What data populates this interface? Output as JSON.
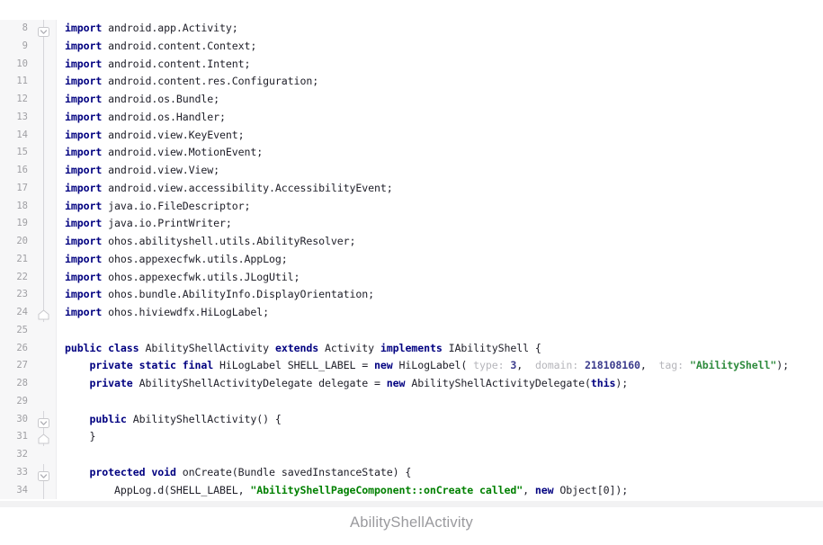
{
  "caption": "AbilityShellActivity",
  "editor": {
    "language": "Java",
    "first_visible_line": 8,
    "last_visible_line": 34,
    "colors": {
      "background": "#ffffff",
      "gutter_background": "#f7f7f8",
      "line_number": "#a0a0a4",
      "keyword": "#000080",
      "string": "#008000",
      "number": "#0000c0",
      "plain_text": "#20202a",
      "inlay_hint_label": "#b6b6bb",
      "caption_text": "#9a9a9e"
    },
    "fold_markers": [
      {
        "line": 8,
        "glyph": "chevron-down-icon"
      },
      {
        "line": 24,
        "glyph": "fold-end-icon"
      },
      {
        "line": 30,
        "glyph": "chevron-down-icon"
      },
      {
        "line": 31,
        "glyph": "fold-end-icon"
      },
      {
        "line": 33,
        "glyph": "chevron-down-icon"
      }
    ],
    "lines": [
      {
        "num": "8",
        "tokens": [
          {
            "t": "kw",
            "v": "import"
          },
          {
            "t": "plain",
            "v": " android.app.Activity;"
          }
        ]
      },
      {
        "num": "9",
        "tokens": [
          {
            "t": "kw",
            "v": "import"
          },
          {
            "t": "plain",
            "v": " android.content.Context;"
          }
        ]
      },
      {
        "num": "10",
        "tokens": [
          {
            "t": "kw",
            "v": "import"
          },
          {
            "t": "plain",
            "v": " android.content.Intent;"
          }
        ]
      },
      {
        "num": "11",
        "tokens": [
          {
            "t": "kw",
            "v": "import"
          },
          {
            "t": "plain",
            "v": " android.content.res.Configuration;"
          }
        ]
      },
      {
        "num": "12",
        "tokens": [
          {
            "t": "kw",
            "v": "import"
          },
          {
            "t": "plain",
            "v": " android.os.Bundle;"
          }
        ]
      },
      {
        "num": "13",
        "tokens": [
          {
            "t": "kw",
            "v": "import"
          },
          {
            "t": "plain",
            "v": " android.os.Handler;"
          }
        ]
      },
      {
        "num": "14",
        "tokens": [
          {
            "t": "kw",
            "v": "import"
          },
          {
            "t": "plain",
            "v": " android.view.KeyEvent;"
          }
        ]
      },
      {
        "num": "15",
        "tokens": [
          {
            "t": "kw",
            "v": "import"
          },
          {
            "t": "plain",
            "v": " android.view.MotionEvent;"
          }
        ]
      },
      {
        "num": "16",
        "tokens": [
          {
            "t": "kw",
            "v": "import"
          },
          {
            "t": "plain",
            "v": " android.view.View;"
          }
        ]
      },
      {
        "num": "17",
        "tokens": [
          {
            "t": "kw",
            "v": "import"
          },
          {
            "t": "plain",
            "v": " android.view.accessibility.AccessibilityEvent;"
          }
        ]
      },
      {
        "num": "18",
        "tokens": [
          {
            "t": "kw",
            "v": "import"
          },
          {
            "t": "plain",
            "v": " java.io.FileDescriptor;"
          }
        ]
      },
      {
        "num": "19",
        "tokens": [
          {
            "t": "kw",
            "v": "import"
          },
          {
            "t": "plain",
            "v": " java.io.PrintWriter;"
          }
        ]
      },
      {
        "num": "20",
        "tokens": [
          {
            "t": "kw",
            "v": "import"
          },
          {
            "t": "plain",
            "v": " ohos.abilityshell.utils.AbilityResolver;"
          }
        ]
      },
      {
        "num": "21",
        "tokens": [
          {
            "t": "kw",
            "v": "import"
          },
          {
            "t": "plain",
            "v": " ohos.appexecfwk.utils.AppLog;"
          }
        ]
      },
      {
        "num": "22",
        "tokens": [
          {
            "t": "kw",
            "v": "import"
          },
          {
            "t": "plain",
            "v": " ohos.appexecfwk.utils.JLogUtil;"
          }
        ]
      },
      {
        "num": "23",
        "tokens": [
          {
            "t": "kw",
            "v": "import"
          },
          {
            "t": "plain",
            "v": " ohos.bundle.AbilityInfo.DisplayOrientation;"
          }
        ]
      },
      {
        "num": "24",
        "tokens": [
          {
            "t": "kw",
            "v": "import"
          },
          {
            "t": "plain",
            "v": " ohos.hiviewdfx.HiLogLabel;"
          }
        ]
      },
      {
        "num": "25",
        "tokens": []
      },
      {
        "num": "26",
        "tokens": [
          {
            "t": "kw",
            "v": "public class"
          },
          {
            "t": "plain",
            "v": " AbilityShellActivity "
          },
          {
            "t": "kw",
            "v": "extends"
          },
          {
            "t": "plain",
            "v": " Activity "
          },
          {
            "t": "kw",
            "v": "implements"
          },
          {
            "t": "plain",
            "v": " IAbilityShell {"
          }
        ]
      },
      {
        "num": "27",
        "tokens": [
          {
            "t": "plain",
            "v": "    "
          },
          {
            "t": "kw",
            "v": "private static final"
          },
          {
            "t": "plain",
            "v": " HiLogLabel SHELL_LABEL = "
          },
          {
            "t": "kw",
            "v": "new"
          },
          {
            "t": "plain",
            "v": " HiLogLabel( "
          },
          {
            "t": "hint",
            "v": "type: "
          },
          {
            "t": "hintnum",
            "v": "3"
          },
          {
            "t": "plain",
            "v": ",  "
          },
          {
            "t": "hint",
            "v": "domain: "
          },
          {
            "t": "hintnum",
            "v": "218108160"
          },
          {
            "t": "plain",
            "v": ",  "
          },
          {
            "t": "hint",
            "v": "tag: "
          },
          {
            "t": "hintstr",
            "v": "\"AbilityShell\""
          },
          {
            "t": "plain",
            "v": ");"
          }
        ]
      },
      {
        "num": "28",
        "tokens": [
          {
            "t": "plain",
            "v": "    "
          },
          {
            "t": "kw",
            "v": "private"
          },
          {
            "t": "plain",
            "v": " AbilityShellActivityDelegate delegate = "
          },
          {
            "t": "kw",
            "v": "new"
          },
          {
            "t": "plain",
            "v": " AbilityShellActivityDelegate("
          },
          {
            "t": "kw",
            "v": "this"
          },
          {
            "t": "plain",
            "v": ");"
          }
        ]
      },
      {
        "num": "29",
        "tokens": []
      },
      {
        "num": "30",
        "tokens": [
          {
            "t": "plain",
            "v": "    "
          },
          {
            "t": "kw",
            "v": "public"
          },
          {
            "t": "plain",
            "v": " AbilityShellActivity() {"
          }
        ]
      },
      {
        "num": "31",
        "tokens": [
          {
            "t": "plain",
            "v": "    }"
          }
        ]
      },
      {
        "num": "32",
        "tokens": []
      },
      {
        "num": "33",
        "tokens": [
          {
            "t": "plain",
            "v": "    "
          },
          {
            "t": "kw",
            "v": "protected void"
          },
          {
            "t": "plain",
            "v": " onCreate(Bundle savedInstanceState) {"
          }
        ]
      },
      {
        "num": "34",
        "tokens": [
          {
            "t": "plain",
            "v": "        AppLog.d(SHELL_LABEL, "
          },
          {
            "t": "str",
            "v": "\"AbilityShellPageComponent::onCreate called\""
          },
          {
            "t": "plain",
            "v": ", "
          },
          {
            "t": "kw",
            "v": "new"
          },
          {
            "t": "plain",
            "v": " Object[0]);"
          }
        ]
      }
    ]
  }
}
